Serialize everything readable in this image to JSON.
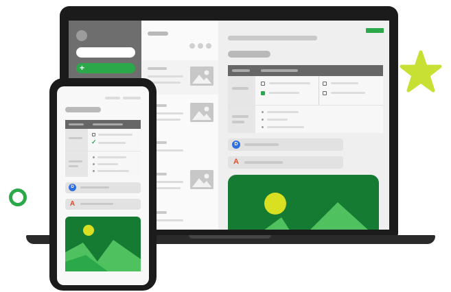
{
  "illustration": {
    "subject": "laptop-and-phone-app-mockup",
    "colors": {
      "accent_green": "#2aa84a",
      "dark_green": "#157a32",
      "light_green": "#4fc15f",
      "sun_yellow": "#d9e021",
      "star": "#c8df34",
      "device_frame": "#1b1b1b",
      "pdf_red": "#e04a2a",
      "doc_blue": "#2f6fe0"
    },
    "icons": {
      "plus": "+",
      "check": "✓",
      "doc_badge": "D",
      "pdf_badge": "A"
    }
  }
}
